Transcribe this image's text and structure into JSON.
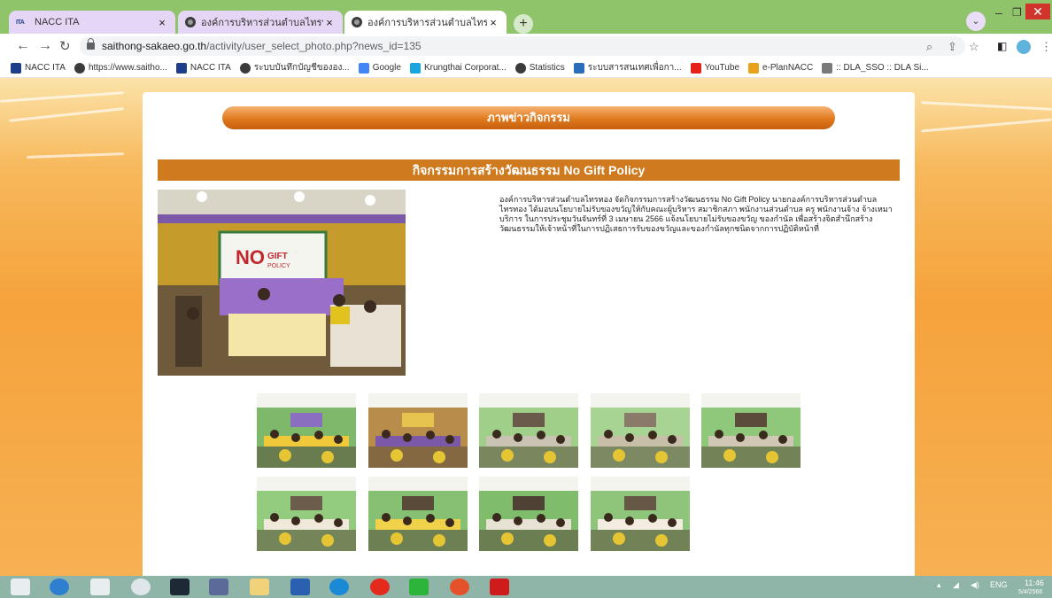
{
  "tabs": [
    {
      "title": "NACC ITA"
    },
    {
      "title": "องค์การบริหารส่วนตำบลไทรทอง อำเภ"
    },
    {
      "title": "องค์การบริหารส่วนตำบลไทรทอง อำเภ"
    }
  ],
  "tab_logo": "ITA",
  "url": {
    "host": "saithong-sakaeo.go.th",
    "path": "/activity/user_select_photo.php?news_id=135"
  },
  "bookmarks": [
    {
      "label": "NACC ITA",
      "icon": "ita-icon",
      "color": "#1d3f8a"
    },
    {
      "label": "https://www.saitho...",
      "icon": "globe-icon",
      "color": "#3b3b3b"
    },
    {
      "label": "NACC ITA",
      "icon": "ita-icon",
      "color": "#1d3f8a"
    },
    {
      "label": "ระบบบันทึกบัญชีขององ...",
      "icon": "globe-icon",
      "color": "#3b3b3b"
    },
    {
      "label": "Google",
      "icon": "google-icon",
      "color": "#4285f4"
    },
    {
      "label": "Krungthai Corporat...",
      "icon": "krungthai-icon",
      "color": "#1ba5e0"
    },
    {
      "label": "Statistics",
      "icon": "globe-icon",
      "color": "#3b3b3b"
    },
    {
      "label": "ระบบสารสนเทศเพื่อกา...",
      "icon": "app-icon",
      "color": "#2a6ebb"
    },
    {
      "label": "YouTube",
      "icon": "youtube-icon",
      "color": "#e62117"
    },
    {
      "label": "e-PlanNACC",
      "icon": "eplan-icon",
      "color": "#e8a21a"
    },
    {
      "label": ":: DLA_SSO :: DLA Si...",
      "icon": "dla-icon",
      "color": "#7a7a7a"
    }
  ],
  "page": {
    "section_title": "ภาพข่าวกิจกรรม",
    "news_title": "กิจกรรมการสร้างวัฒนธรรม No Gift Policy",
    "description": "องค์การบริหารส่วนตำบลไทรทอง จัดกิจกรรมการสร้างวัฒนธรรม No Gift Policy นายกองค์การบริหารส่วนตำบลไทรทอง ได้มอบนโยบายไม่รับของขวัญให้กับคณะผู้บริหาร สมาชิกสภา พนักงานส่วนตำบล ครู พนักงานจ้าง จ้างเหมาบริการ ในการประชุมวันจันทร์ที่ 3 เมษายน 2566 แจ้งนโยบายไม่รับของขวัญ ของกำนัล เพื่อสร้างจิตสำนึกสร้างวัฒนธรรมให้เจ้าหน้าที่ในการปฏิเสธการรับของขวัญและของกำนัลทุกชนิดจากการปฏิบัติหน้าที่",
    "banner_text": "NO GIFT POLICY",
    "thumb_count": 9
  },
  "tray": {
    "lang": "ENG",
    "time": "11:46",
    "date": "5/4/2566"
  },
  "colors": {
    "tabstrip": "#8fc46b",
    "accent": "#d07a1f",
    "page_bg": "#f5a33c"
  }
}
